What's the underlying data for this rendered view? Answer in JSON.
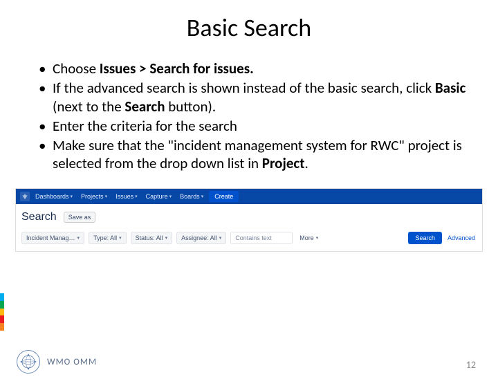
{
  "title": "Basic Search",
  "bullets": {
    "b1": {
      "pre": "Choose ",
      "bold": "Issues > Search for issues.",
      "post": ""
    },
    "b2": {
      "pre": "If the advanced search is shown instead of the basic search, click ",
      "bold1": "Basic",
      "mid": " (next to the ",
      "bold2": "Search",
      "post": " button)."
    },
    "b3": {
      "text": "Enter the criteria for the search"
    },
    "b4": {
      "pre": "Make sure that the \"incident management system for RWC\" project is selected from the drop down list in ",
      "bold": "Project",
      "post": "."
    }
  },
  "app": {
    "nav": {
      "dashboards": "Dashboards",
      "projects": "Projects",
      "issues": "Issues",
      "capture": "Capture",
      "boards": "Boards",
      "create": "Create"
    },
    "search_heading": "Search",
    "save_as": "Save as",
    "filters": {
      "project": "Incident Manag…",
      "type": "Type: All",
      "status": "Status: All",
      "assignee": "Assignee: All",
      "contains_placeholder": "Contains text",
      "more": "More",
      "search_btn": "Search",
      "advanced": "Advanced"
    }
  },
  "footer": {
    "org": "WMO OMM",
    "page": "12"
  }
}
